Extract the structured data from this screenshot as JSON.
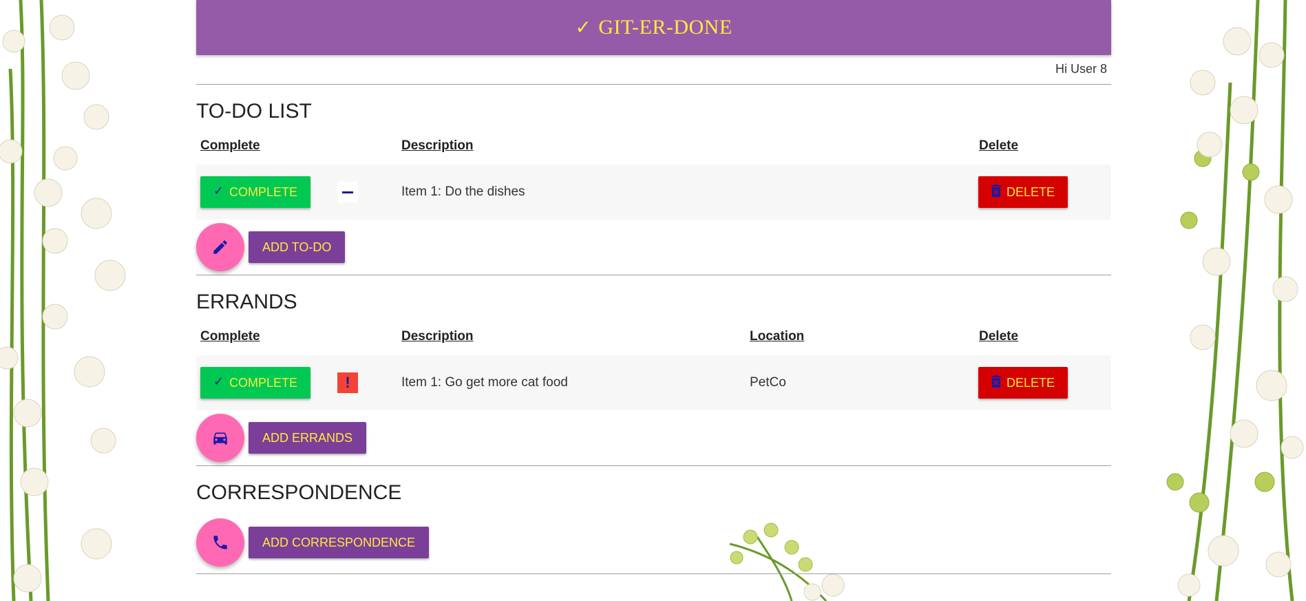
{
  "app": {
    "title": "GIT-ER-DONE",
    "greeting": "Hi User 8"
  },
  "todo": {
    "heading": "TO-DO LIST",
    "headers": {
      "complete": "Complete",
      "description": "Description",
      "delete": "Delete"
    },
    "items": [
      {
        "complete_label": "COMPLETE",
        "description": "Item 1: Do the dishes",
        "delete_label": "DELETE",
        "priority": "normal"
      }
    ],
    "add_label": "ADD TO-DO",
    "add_icon": "pencil-icon"
  },
  "errands": {
    "heading": "ERRANDS",
    "headers": {
      "complete": "Complete",
      "description": "Description",
      "location": "Location",
      "delete": "Delete"
    },
    "items": [
      {
        "complete_label": "COMPLETE",
        "description": "Item 1: Go get more cat food",
        "location": "PetCo",
        "delete_label": "DELETE",
        "priority": "urgent"
      }
    ],
    "add_label": "ADD ERRANDS",
    "add_icon": "car-icon"
  },
  "correspondence": {
    "heading": "CORRESPONDENCE",
    "add_label": "ADD CORRESPONDENCE",
    "add_icon": "phone-icon"
  },
  "colors": {
    "banner": "#965ba8",
    "accent_text": "#ffeb3b",
    "complete": "#00c853",
    "delete": "#d50000",
    "add": "#7b3f99",
    "fab": "#ff69b4"
  }
}
